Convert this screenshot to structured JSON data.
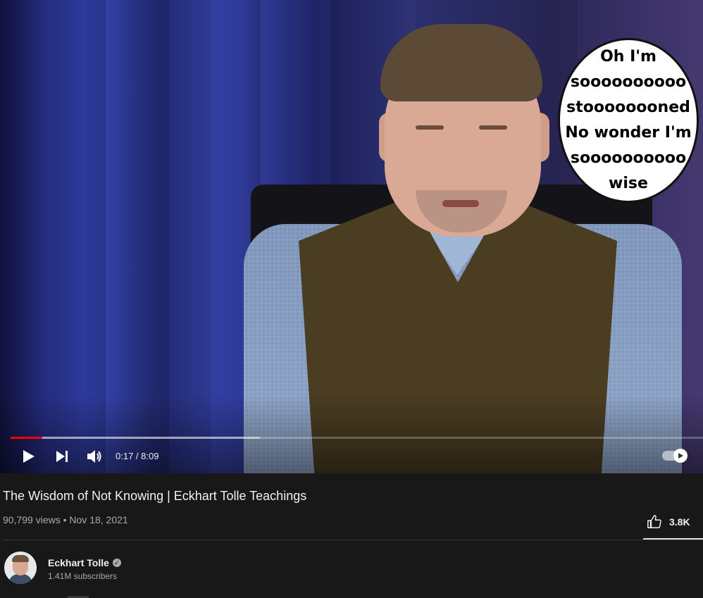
{
  "video": {
    "caption_lines": [
      "Oh I'm",
      "soooooooooo",
      "stoooooooned",
      "No wonder I'm",
      "soooooooooo",
      "wise"
    ],
    "time_display": "0:17 / 8:09",
    "progress_played_fraction": 0.046,
    "progress_buffered_fraction": 0.36,
    "icons": {
      "play": "play-icon",
      "next": "next-icon",
      "volume": "volume-icon",
      "autoplay": "autoplay-toggle-icon"
    }
  },
  "details": {
    "title": "The Wisdom of Not Knowing | Eckhart Tolle Teachings",
    "views": "90,799 views",
    "separator": "•",
    "date": "Nov 18, 2021",
    "like_count": "3.8K"
  },
  "channel": {
    "name": "Eckhart Tolle",
    "verified_glyph": "✓",
    "subscribers": "1.41M subscribers"
  },
  "colors": {
    "background": "#181818",
    "progress_played": "#ff0000",
    "text_primary": "#f1f1f1",
    "text_secondary": "#aaaaaa"
  }
}
